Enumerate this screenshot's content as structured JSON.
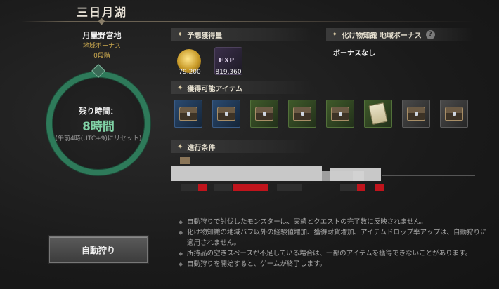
{
  "header": {
    "title": "三日月湖"
  },
  "camp": {
    "name": "月暈野営地",
    "region_bonus_label": "地域ボーナス",
    "level": "0段階"
  },
  "timer": {
    "label": "残り時間：",
    "value": "8時間",
    "reset_note": "(午前4時(UTC+9)にリセット)"
  },
  "auto_hunt": {
    "button_label": "自動狩り"
  },
  "sections": {
    "expected_rewards": "予想獲得量",
    "knowledge_bonus": "化け物知識 地域ボーナス",
    "obtainable_items": "獲得可能アイテム",
    "progress_conditions": "進行条件"
  },
  "knowledge_bonus_value": "ボーナスなし",
  "rewards": [
    {
      "icon": "gold-coin-icon",
      "qty": "79,200"
    },
    {
      "icon": "exp-icon",
      "label": "EXP",
      "qty": "819,360"
    }
  ],
  "items": [
    {
      "icon": "chest-icon",
      "rarity": "blue"
    },
    {
      "icon": "chest-icon",
      "rarity": "blue"
    },
    {
      "icon": "chest-icon",
      "rarity": "green"
    },
    {
      "icon": "chest-icon",
      "rarity": "green"
    },
    {
      "icon": "chest-icon",
      "rarity": "green"
    },
    {
      "icon": "scroll-icon",
      "rarity": "green"
    },
    {
      "icon": "chest-icon",
      "rarity": "grey"
    },
    {
      "icon": "chest-icon",
      "rarity": "grey"
    }
  ],
  "notes": [
    "自動狩りで討伐したモンスターは、実績とクエストの完了数に反映されません。",
    "化け物知識の地域バフ以外の経験値増加、獲得財貨増加、アイテムドロップ率アップは、自動狩りに適用されません。",
    "所持品の空きスペースが不足している場合は、一部のアイテムを獲得できないことがあります。",
    "自動狩りを開始すると、ゲームが終了します。"
  ],
  "colors": {
    "accent_gold": "#c9a84f",
    "timer_green": "#7fd0a4",
    "ring_green": "#2e7a5a"
  }
}
